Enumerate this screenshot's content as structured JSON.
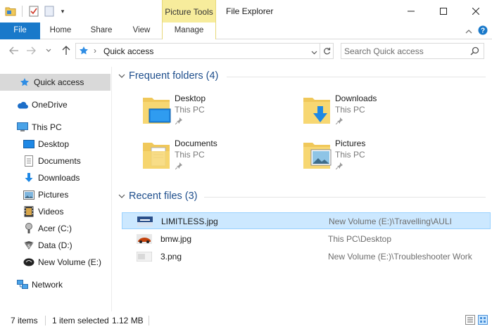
{
  "window": {
    "title": "File Explorer",
    "contextual_tab_group": "Picture Tools",
    "quick_access_toolbar": [
      "folder-icon",
      "properties-icon",
      "new-folder-icon",
      "customize-icon"
    ]
  },
  "ribbon": {
    "tabs": [
      {
        "label": "File"
      },
      {
        "label": "Home"
      },
      {
        "label": "Share"
      },
      {
        "label": "View"
      },
      {
        "label": "Manage"
      }
    ],
    "accent": "#1979ca",
    "context_color": "#f7ec9c"
  },
  "address": {
    "path": "Quick access"
  },
  "search": {
    "placeholder": "Search Quick access"
  },
  "nav": {
    "items": [
      {
        "label": "Quick access",
        "icon": "star-icon"
      },
      {
        "label": "OneDrive",
        "icon": "cloud-icon"
      },
      {
        "label": "This PC",
        "icon": "computer-icon"
      },
      {
        "label": "Desktop",
        "icon": "desktop-icon"
      },
      {
        "label": "Documents",
        "icon": "documents-icon"
      },
      {
        "label": "Downloads",
        "icon": "download-icon"
      },
      {
        "label": "Pictures",
        "icon": "pictures-icon"
      },
      {
        "label": "Videos",
        "icon": "videos-icon"
      },
      {
        "label": "Acer (C:)",
        "icon": "drive-icon"
      },
      {
        "label": "Data (D:)",
        "icon": "drive-icon"
      },
      {
        "label": "New Volume (E:)",
        "icon": "drive-icon"
      },
      {
        "label": "Network",
        "icon": "network-icon"
      }
    ]
  },
  "frequent": {
    "title": "Frequent folders (4)",
    "folders": [
      {
        "name": "Desktop",
        "location": "This PC"
      },
      {
        "name": "Downloads",
        "location": "This PC"
      },
      {
        "name": "Documents",
        "location": "This PC"
      },
      {
        "name": "Pictures",
        "location": "This PC"
      }
    ]
  },
  "recent": {
    "title": "Recent files (3)",
    "files": [
      {
        "name": "LIMITLESS.jpg",
        "location": "New Volume (E:)\\Travelling\\AULI"
      },
      {
        "name": "bmw.jpg",
        "location": "This PC\\Desktop"
      },
      {
        "name": "3.png",
        "location": "New Volume (E:)\\Troubleshooter Work"
      }
    ]
  },
  "status": {
    "item_count": "7 items",
    "selection": "1 item selected",
    "size": "1.12 MB"
  }
}
